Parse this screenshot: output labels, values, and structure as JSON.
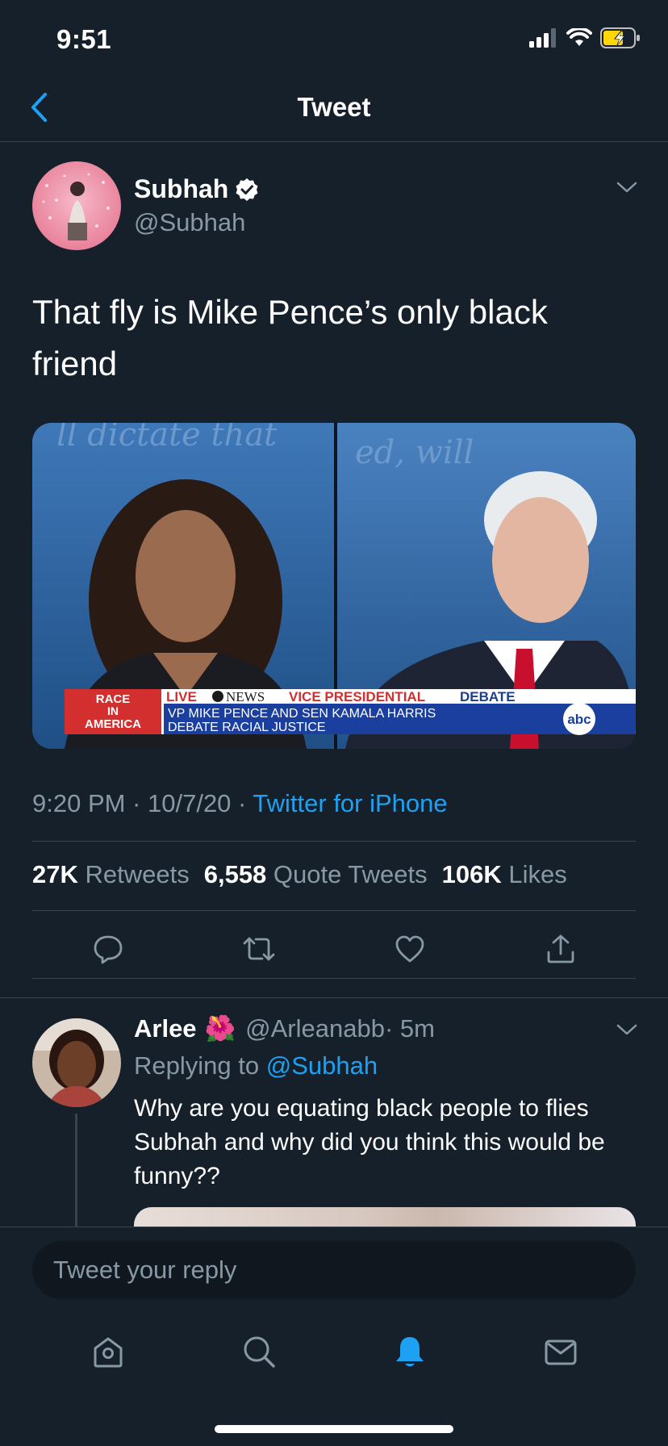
{
  "status_bar": {
    "time": "9:51"
  },
  "nav": {
    "title": "Tweet"
  },
  "tweet": {
    "author_name": "Subhah",
    "author_handle": "@Subhah",
    "verified": true,
    "text": "That fly is Mike Pence’s only black friend",
    "timestamp": "9:20 PM · 10/7/20 · ",
    "source": "Twitter for iPhone",
    "retweets_count": "27K",
    "retweets_label": " Retweets",
    "quote_count": "6,558",
    "quote_label": " Quote Tweets",
    "likes_count": "106K",
    "likes_label": " Likes",
    "media": {
      "bg_left_words": "ll dictate that",
      "bg_right_words": "ed, will",
      "chyron_race_line1": "RACE",
      "chyron_race_line2": "IN",
      "chyron_race_line3": "AMERICA",
      "chyron_live": "LIVE",
      "chyron_network": "NEWS",
      "chyron_event_part1": "VICE PRESIDENTIAL",
      "chyron_event_part2": "DEBATE",
      "chyron_line1": "VP MIKE PENCE AND SEN KAMALA HARRIS",
      "chyron_line2": "DEBATE RACIAL JUSTICE",
      "chyron_logo": "abc"
    }
  },
  "reply": {
    "author_name": "Arlee",
    "author_emoji": "🌺",
    "author_handle": "@Arleanabb",
    "time": " · 5m",
    "replying_prefix": "Replying to ",
    "replying_to": "@Subhah",
    "text": "Why are you equating black people to flies Subhah and why did you think this would be funny??"
  },
  "composer": {
    "placeholder": "Tweet your reply"
  },
  "colors": {
    "background": "#15202b",
    "accent": "#1da1f2",
    "secondary_text": "#8899a6",
    "divider": "#38444d"
  },
  "icons": {
    "back": "chevron-left-icon",
    "caret": "chevron-down-icon",
    "reply": "comment-icon",
    "retweet": "retweet-icon",
    "like": "heart-icon",
    "share": "share-icon",
    "home": "home-icon",
    "search": "search-icon",
    "notifications": "bell-icon",
    "messages": "mail-icon"
  }
}
